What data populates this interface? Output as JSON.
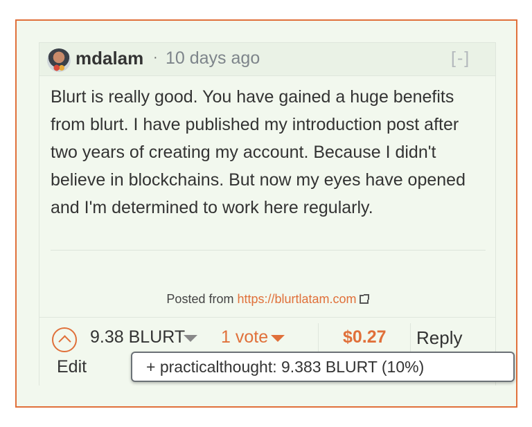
{
  "comment": {
    "author": "mdalam",
    "separator": "·",
    "time_ago": "10 days ago",
    "collapse_label": "[-]",
    "body": "Blurt is really good. You have gained a huge benefits from blurt. I have published my introduction post after two years of creating my account. Because I didn't believe in blockchains. But now my eyes have opened and I'm determined to work here regularly.",
    "posted_from_label": "Posted from",
    "posted_from_url": "https://blurtlatam.com"
  },
  "footer": {
    "payout": "9.38 BLURT",
    "votes_label": "1 vote",
    "dollar_value": "$0.27",
    "reply_label": "Reply",
    "edit_label": "Edit"
  },
  "voters_popup": {
    "entries": [
      "+ practicalthought: 9.383 BLURT (10%)"
    ]
  },
  "colors": {
    "accent": "#e0703a",
    "background": "#f2f8ee",
    "text": "#333333"
  },
  "icons": {
    "upvote": "chevron-up-circle-icon",
    "payout_dropdown": "caret-down-icon",
    "votes_dropdown": "caret-down-icon",
    "external_link": "external-link-icon"
  }
}
